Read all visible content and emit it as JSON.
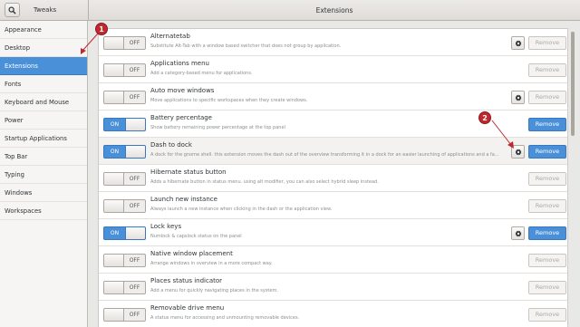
{
  "app": {
    "title": "Tweaks",
    "page_title": "Extensions"
  },
  "sidebar": {
    "items": [
      {
        "label": "Appearance"
      },
      {
        "label": "Desktop"
      },
      {
        "label": "Extensions"
      },
      {
        "label": "Fonts"
      },
      {
        "label": "Keyboard and Mouse"
      },
      {
        "label": "Power"
      },
      {
        "label": "Startup Applications"
      },
      {
        "label": "Top Bar"
      },
      {
        "label": "Typing"
      },
      {
        "label": "Windows"
      },
      {
        "label": "Workspaces"
      }
    ],
    "selected": "Extensions"
  },
  "extensions": [
    {
      "name": "Alternatetab",
      "description": "Substitute Alt-Tab with a window based switcher that does not group by application.",
      "toggle": "OFF",
      "settings": true,
      "remove": "Remove"
    },
    {
      "name": "Applications menu",
      "description": "Add a category-based menu for applications.",
      "toggle": "OFF",
      "settings": false,
      "remove": "Remove"
    },
    {
      "name": "Auto move windows",
      "description": "Move applications to specific workspaces when they create windows.",
      "toggle": "OFF",
      "settings": true,
      "remove": "Remove"
    },
    {
      "name": "Battery percentage",
      "description": "Show battery remaining power percentage at the top panel",
      "toggle": "ON",
      "settings": false,
      "remove": "Remove"
    },
    {
      "name": "Dash to dock",
      "description": "A dock for the gnome shell. this extension moves the dash out of the overview transforming it in a dock for an easier launching of applications and a fa...",
      "toggle": "ON",
      "settings": true,
      "remove": "Remove"
    },
    {
      "name": "Hibernate status button",
      "description": "Adds a hibernate button in status menu. using alt modifier, you can also select hybrid sleep instead.",
      "toggle": "OFF",
      "settings": false,
      "remove": "Remove"
    },
    {
      "name": "Launch new instance",
      "description": "Always launch a new instance when clicking in the dash or the application view.",
      "toggle": "OFF",
      "settings": false,
      "remove": "Remove"
    },
    {
      "name": "Lock keys",
      "description": "Numlock & capslock status on the panel",
      "toggle": "ON",
      "settings": true,
      "remove": "Remove"
    },
    {
      "name": "Native window placement",
      "description": "Arrange windows in overview in a more compact way.",
      "toggle": "OFF",
      "settings": false,
      "remove": "Remove"
    },
    {
      "name": "Places status indicator",
      "description": "Add a menu for quickly navigating places in the system.",
      "toggle": "OFF",
      "settings": false,
      "remove": "Remove"
    },
    {
      "name": "Removable drive menu",
      "description": "A status menu for accessing and unmounting removable devices.",
      "toggle": "OFF",
      "settings": false,
      "remove": "Remove"
    }
  ],
  "annotations": [
    {
      "label": "1"
    },
    {
      "label": "2"
    }
  ],
  "colors": {
    "accent": "#4a90d9",
    "annotation": "#c0282e"
  },
  "icons": {
    "search": "search-icon",
    "settings": "gear-icon"
  }
}
